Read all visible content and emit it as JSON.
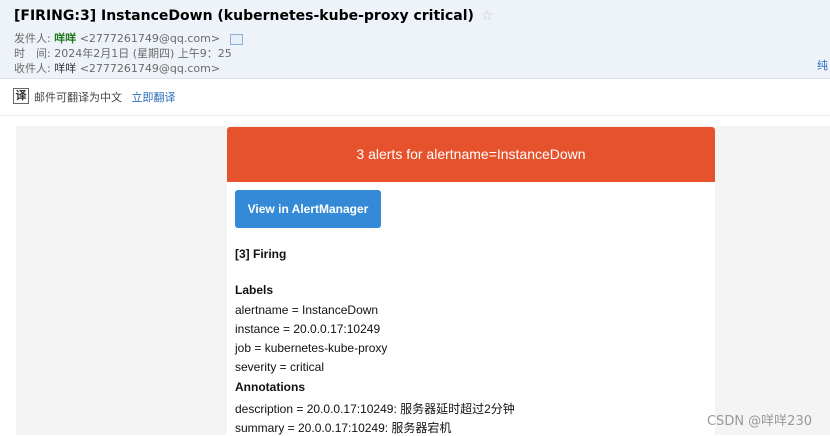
{
  "email": {
    "subject": "[FIRING:3] InstanceDown (kubernetes-kube-proxy critical)",
    "star_icon": "☆",
    "from_label": "发件人:",
    "from_name": "咩咩",
    "from_addr": "<2777261749@qq.com>",
    "time_label": "时　间:",
    "time_value": "2024年2月1日 (星期四) 上午9：25",
    "to_label": "收件人:",
    "to_name": "咩咩",
    "to_addr": "<2777261749@qq.com>",
    "pure_text": "纯"
  },
  "translate": {
    "icon": "译",
    "text": "邮件可翻译为中文",
    "link": "立即翻译"
  },
  "alert": {
    "banner": "3 alerts for alertname=InstanceDown",
    "button": "View in AlertManager",
    "firing": "[3] Firing",
    "labels_heading": "Labels",
    "labels": [
      "alertname = InstanceDown",
      "instance = 20.0.0.17:10249",
      "job = kubernetes-kube-proxy",
      "severity = critical"
    ],
    "annotations_heading": "Annotations",
    "annotations": [
      "description = 20.0.0.17:10249: 服务器延时超过2分钟",
      "summary = 20.0.0.17:10249: 服务器宕机"
    ]
  },
  "watermark": "CSDN @咩咩230",
  "colors": {
    "banner": "#e6522c",
    "button": "#348ad6",
    "header_bg": "#eef3f9"
  }
}
